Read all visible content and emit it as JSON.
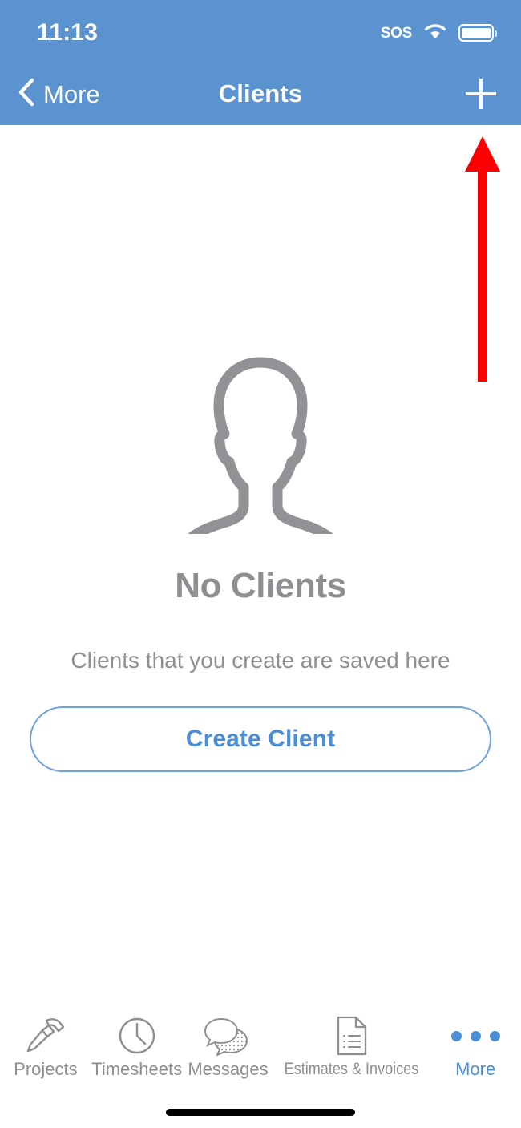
{
  "status_bar": {
    "time": "11:13",
    "sos_label": "SOS",
    "wifi_icon": "wifi-icon",
    "battery_icon": "battery-full-icon"
  },
  "nav_bar": {
    "back_icon": "chevron-left-icon",
    "back_label": "More",
    "title": "Clients",
    "add_icon": "plus-icon",
    "background_color": "#5b93d1"
  },
  "empty_state": {
    "icon": "person-silhouette-icon",
    "title": "No Clients",
    "subtitle": "Clients that you create are saved here",
    "button_label": "Create Client",
    "button_color": "#4a8fd4"
  },
  "annotation": {
    "arrow_icon": "up-arrow-annotation",
    "color": "#fa0000"
  },
  "tab_bar": {
    "items": [
      {
        "label": "Projects",
        "icon": "hammer-icon",
        "active": false
      },
      {
        "label": "Timesheets",
        "icon": "clock-icon",
        "active": false
      },
      {
        "label": "Messages",
        "icon": "speech-bubbles-icon",
        "active": false
      },
      {
        "label": "Estimates & Invoices",
        "icon": "document-list-icon",
        "active": false
      },
      {
        "label": "More",
        "icon": "ellipsis-icon",
        "active": true
      }
    ],
    "active_color": "#4a8fd4",
    "inactive_color": "#8e8e93"
  },
  "home_indicator": "home-indicator-bar"
}
